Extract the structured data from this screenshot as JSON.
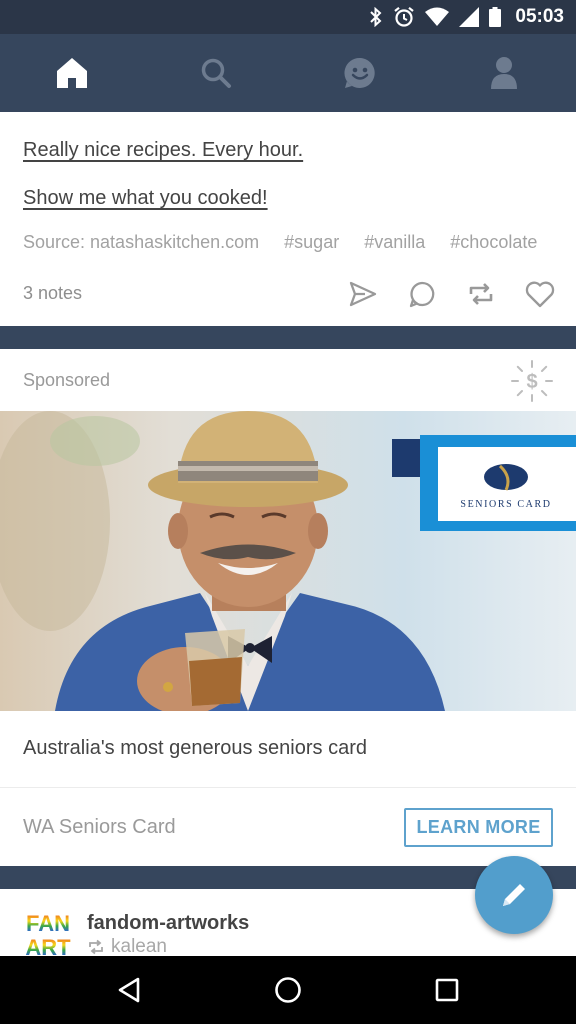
{
  "status_bar": {
    "time": "05:03",
    "icons": [
      "bluetooth-icon",
      "alarm-icon",
      "wifi-icon",
      "signal-icon",
      "battery-icon"
    ]
  },
  "nav": {
    "tabs": [
      "home-icon",
      "search-icon",
      "activity-smiley-icon",
      "account-icon"
    ],
    "active": "home"
  },
  "post": {
    "line1": "Really nice recipes. Every hour.",
    "line2": "Show me what you cooked!",
    "source": "Source: natashaskitchen.com",
    "tags": [
      "#sugar",
      "#vanilla",
      "#chocolate"
    ],
    "notes": "3 notes",
    "actions": [
      "share-icon",
      "reply-icon",
      "reblog-icon",
      "like-icon"
    ]
  },
  "ad": {
    "sponsored_label": "Sponsored",
    "image_card_text": "SENIORS CARD",
    "headline": "Australia's most generous seniors card",
    "advertiser": "WA Seniors Card",
    "cta": "LEARN MORE"
  },
  "blog": {
    "avatar_text_top": "FAN",
    "avatar_text_bottom": "ART",
    "name": "fandom-artworks",
    "reblogged_from": "kalean"
  },
  "colors": {
    "nav_bg": "#36465d",
    "status_bg": "#2b3648",
    "accent": "#529ecc",
    "cta": "#5ea2cd"
  }
}
